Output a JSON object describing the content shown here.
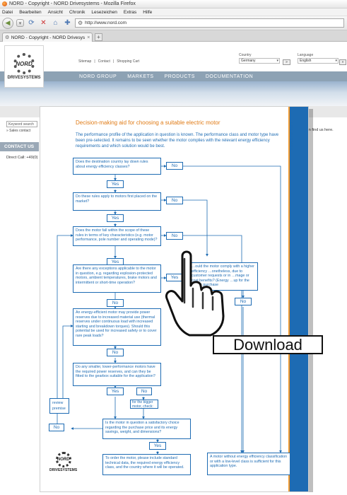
{
  "browser": {
    "title": "NORD - Copyright - NORD Drivesystems - Mozilla Firefox",
    "menu": [
      "Datei",
      "Bearbeiten",
      "Ansicht",
      "Chronik",
      "Lesezeichen",
      "Extras",
      "Hilfe"
    ],
    "url": "http://www.nord.com",
    "tab_title": "NORD - Copyright - NORD Drivesyste...",
    "new_tab": "+"
  },
  "site": {
    "logo_text": "NORD",
    "logo_sub": "DRIVESYSTEMS",
    "toplinks": [
      "Sitemap",
      "|",
      "Contact",
      "|",
      "Shopping Cart"
    ],
    "country_label": "Country",
    "country_value": "Germany",
    "language_label": "Language",
    "language_value": "English",
    "go_label": "»",
    "nav": [
      "NORD GROUP",
      "MARKETS",
      "PRODUCTS",
      "DOCUMENTATION"
    ],
    "search_placeholder": "Keyword search",
    "sales_link": "» Sales contact",
    "contact_us": "CONTACT US",
    "direct_call": "Direct Call: +49(0)",
    "find_us": "can find us here."
  },
  "document": {
    "title": "Decision-making aid for choosing a suitable electric motor",
    "intro": "The performance profile of the application in question is known. The performance class and motor type have been pre-selected. It remains to be seen whether the motor complies with the relevant energy efficiency requirements and which solution would be best.",
    "side_url": "www.nord.com",
    "q1": "Does the destination country lay down rules about energy efficiency classes?",
    "q2": "Do these rules apply to motors first placed on the market?",
    "q3": "Does the motor fall within the scope of these rules in terms of key characteristics (e.g. motor performance, pole number and operating mode)?",
    "q4": "Are there any exceptions applicable to the motor in question, e.g. regarding explosion-protected motors, ambient temperatures, brake motors and intermittent or short-time operation?",
    "q5": "An energy-efficient motor may provide power reserves due to increased material use (thermal reserves under continuous load with increased starting and breakdown torques). Should this potential be used for increased safety or to cover rare peak loads?",
    "q6": "Do any smaller, lower-performance motors have the required power reserves, and can they be fitted to the gearbox suitable for the application?",
    "q7": "Is the motor in question a satisfactory choice regarding the purchase price and its energy savings, weight, and dimensions?",
    "q8": "To order the motor, please include standard technical data, the required energy efficiency class, and the country where it will be operated.",
    "q_right": "…ould the motor comply with a higher efficiency …onetheless, due to customer requests or in …mage or cost benefits? (Energy …up for the higher purchase",
    "q_final": "A motor without energy efficiency classification or with a low-level class is sufficient for this application type.",
    "review": "review premise",
    "bigger": "for the bigger motor, check:",
    "yes": "Yes",
    "no": "No",
    "logo_text": "NORD",
    "logo_sub": "DRIVESYSTEMS"
  },
  "download_label": "Download"
}
